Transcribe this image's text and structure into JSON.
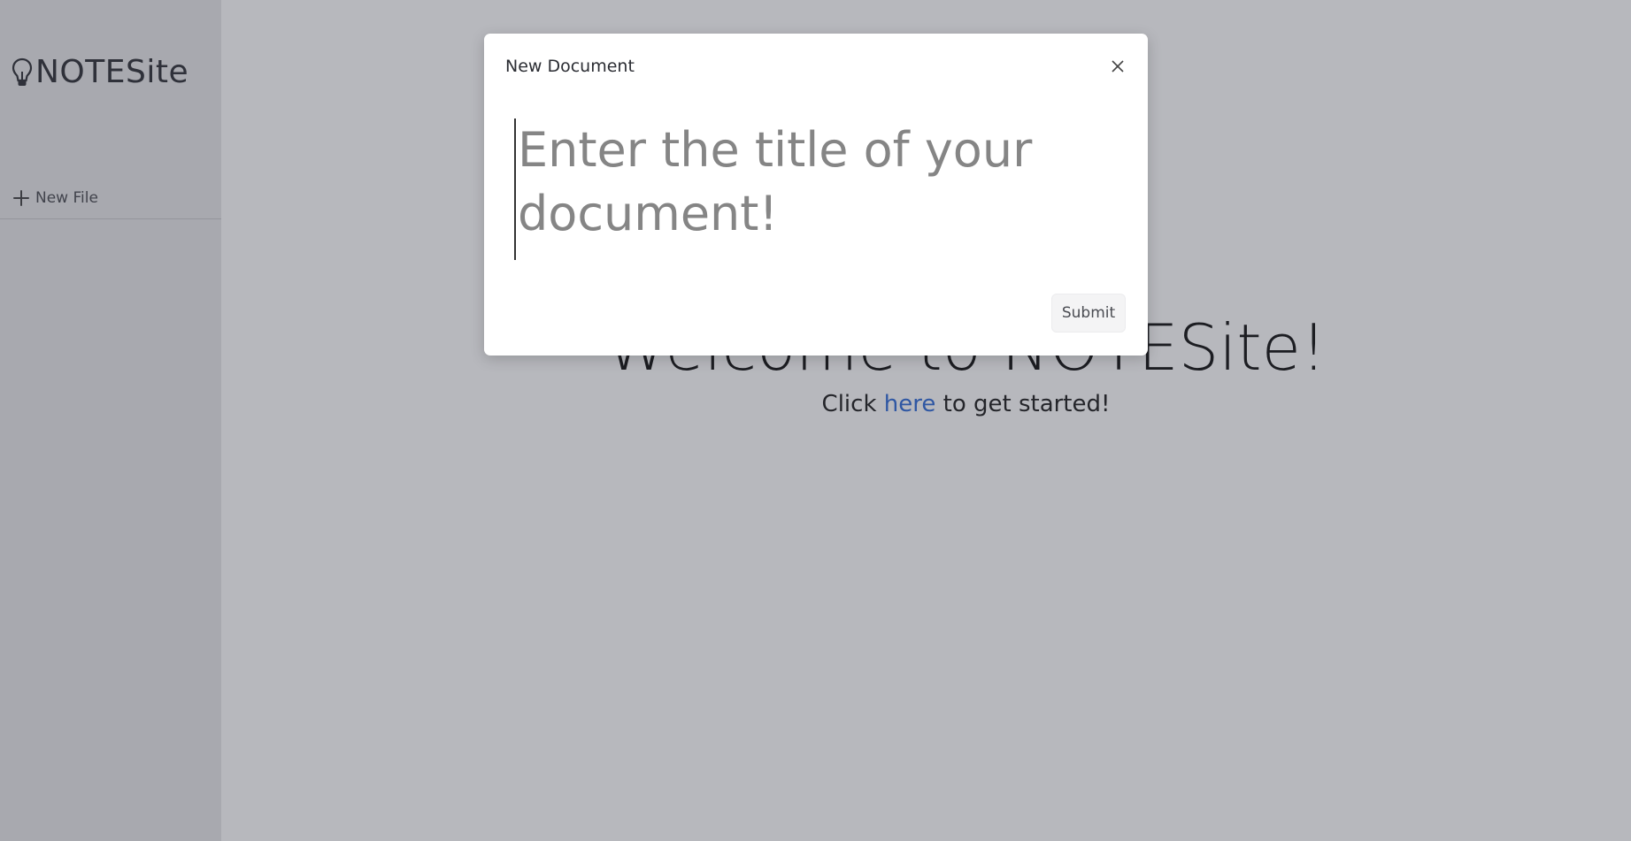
{
  "sidebar": {
    "brand": {
      "icon": "lightbulb-icon",
      "name": "NOTESite"
    },
    "new_file": {
      "icon": "plus-icon",
      "label": "New File"
    }
  },
  "main": {
    "welcome_title": "Welcome to NOTESite!",
    "welcome_sub_prefix": "Click ",
    "welcome_link": "here",
    "welcome_sub_suffix": " to get started!"
  },
  "modal": {
    "title": "New Document",
    "close_icon": "close-icon",
    "input_placeholder": "Enter the title of your document!",
    "input_value": "",
    "submit_label": "Submit"
  },
  "colors": {
    "link": "#2f6bd8",
    "backdrop": "#303442"
  }
}
